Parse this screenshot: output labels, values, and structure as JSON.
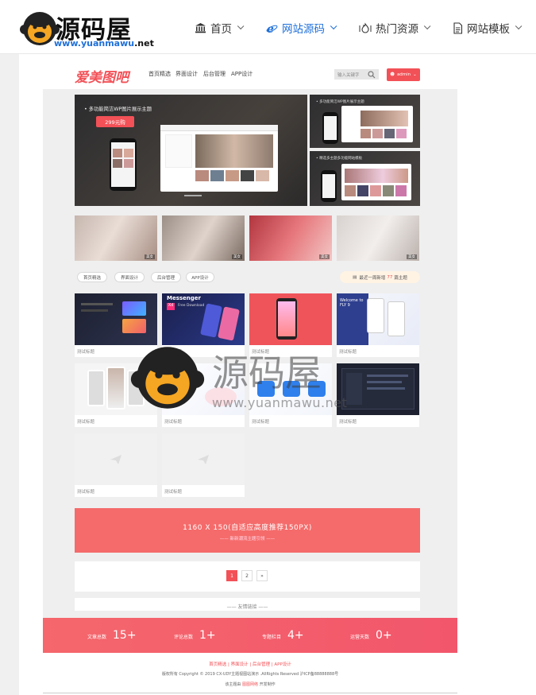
{
  "site": {
    "brand_name": "源码屋",
    "brand_url_a": "www.yuanmawu",
    "brand_url_b": ".net",
    "nav": [
      {
        "label": "首页",
        "icon": "bank-icon"
      },
      {
        "label": "网站源码",
        "icon": "ie-icon",
        "active": true
      },
      {
        "label": "热门资源",
        "icon": "fire-icon"
      },
      {
        "label": "网站模板",
        "icon": "document-icon"
      }
    ],
    "watermark_text": "源码屋",
    "watermark_url": "www.yuanmawu.net"
  },
  "preview": {
    "logo": "爱美图吧",
    "nav": [
      "首页精选",
      "界面设计",
      "后台管理",
      "APP设计"
    ],
    "search_placeholder": "输入关键字",
    "login_label": "admin",
    "hero": {
      "main_text": "• 多功能简洁WP图片展示主题",
      "main_badge": "299元购",
      "side_1_caption": "• 多功能简洁WP图片展示主题",
      "side_2_caption": "• 精选多主题多功能网站模板"
    },
    "photo_tags": [
      "美女",
      "美女",
      "美女",
      "美女"
    ],
    "tabs": [
      "首页精选",
      "界面设计",
      "后台管理",
      "APP设计"
    ],
    "notice": {
      "prefix": "最近一周新增",
      "count": "77",
      "suffix": "篇主题"
    },
    "cards": [
      {
        "title": "测试标题"
      },
      {
        "title": "测试标题"
      },
      {
        "title": "测试标题"
      },
      {
        "title": "测试标题"
      },
      {
        "title": "测试标题"
      },
      {
        "title": "测试标题"
      },
      {
        "title": "测试标题"
      },
      {
        "title": "测试标题"
      },
      {
        "title": "测试标题"
      },
      {
        "title": "测试标题"
      }
    ],
    "card_2_heading": "Messenger",
    "card_2_sub": "Free Download",
    "card_4_heading": "Welcome to FLY 9",
    "ad": {
      "line1": "1160 X 150(自适应高度推荐150PX)",
      "line2": "—— 新新潮流主题引领 ——"
    },
    "pager": [
      "1",
      "2",
      "»"
    ],
    "links_title": "—— 友情链接 ——",
    "stats": [
      {
        "label": "文章总数",
        "value": "15+"
      },
      {
        "label": "评论总数",
        "value": "1+"
      },
      {
        "label": "专题栏目",
        "value": "4+"
      },
      {
        "label": "运营天数",
        "value": "0+"
      }
    ],
    "footer": {
      "links": "首页精选  |  界面设计  |  后台管理  |  APP设计",
      "copyright": "版权所有 Copyright © 2019 CX-UDY主题视图站演示 .AllRights Reserved 沪ICP备88888888号",
      "theme_prefix": "该主题由",
      "theme_name": "图图网络",
      "theme_suffix": "开发制作"
    }
  },
  "colors": {
    "accent": "#f25157",
    "link_blue": "#1e6fd9",
    "ad_bg": "#f56b6b"
  }
}
